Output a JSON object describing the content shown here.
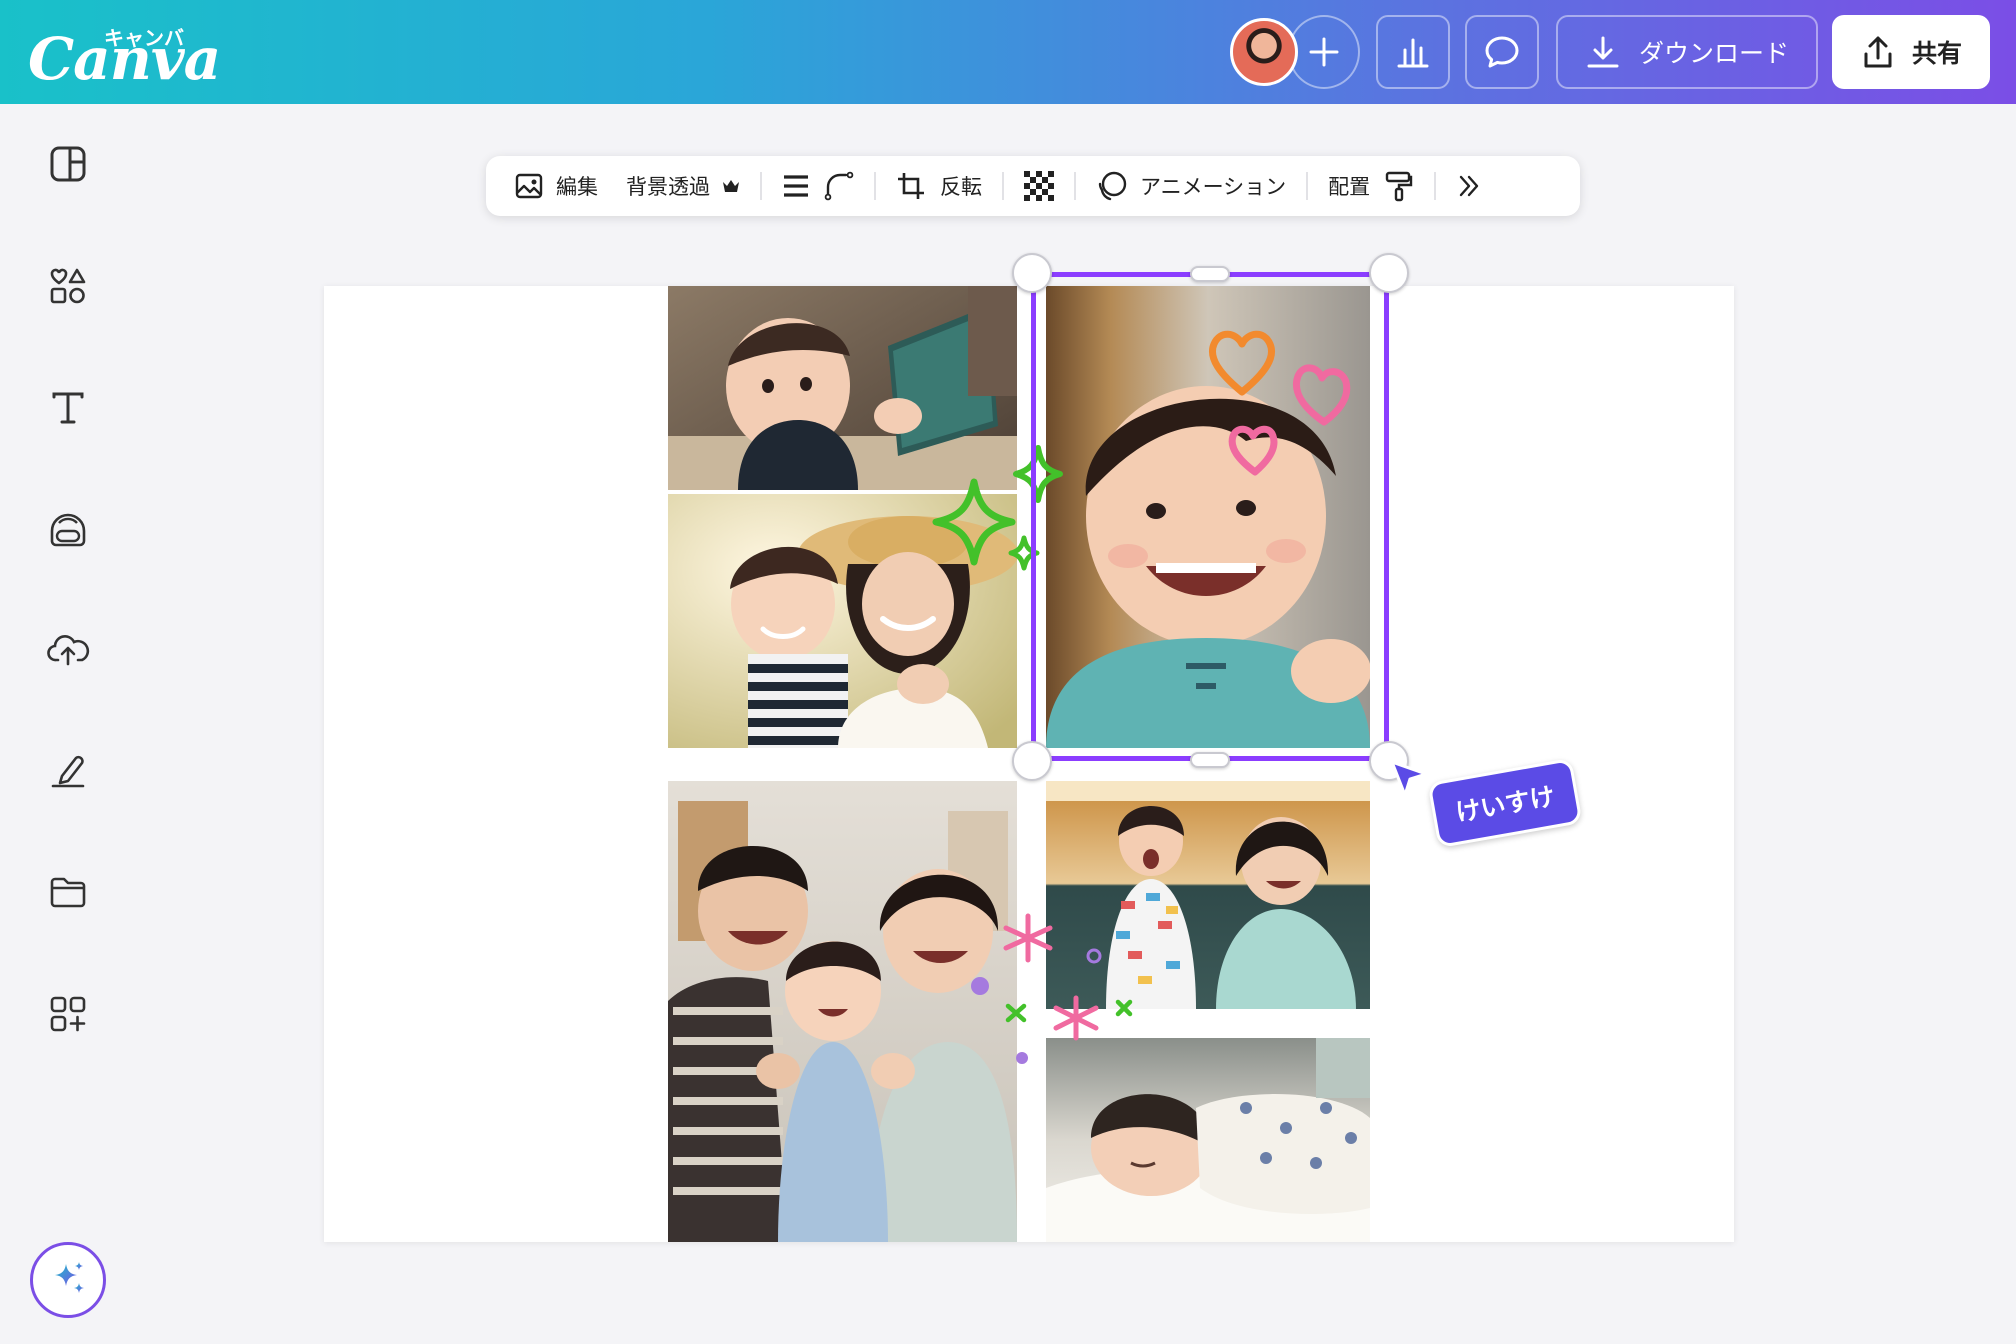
{
  "app": {
    "logo_text": "Canva",
    "logo_kana": "キャンバ"
  },
  "header": {
    "download_label": "ダウンロード",
    "share_label": "共有"
  },
  "sidebar": {
    "items": [
      {
        "icon": "layout-icon"
      },
      {
        "icon": "elements-icon"
      },
      {
        "icon": "text-icon"
      },
      {
        "icon": "brand-icon"
      },
      {
        "icon": "upload-icon"
      },
      {
        "icon": "draw-icon"
      },
      {
        "icon": "projects-icon"
      },
      {
        "icon": "apps-icon"
      }
    ],
    "magic_icon": "magic-sparkle-icon"
  },
  "toolbar": {
    "edit_label": "編集",
    "bg_remove_label": "背景透過",
    "flip_label": "反転",
    "animation_label": "アニメーション",
    "position_label": "配置"
  },
  "collaborator": {
    "name": "けいすけ",
    "color": "#5b4be6"
  },
  "colors": {
    "selection": "#8b3dff",
    "header_start": "#19c1c9",
    "header_end": "#7b4ee6"
  }
}
